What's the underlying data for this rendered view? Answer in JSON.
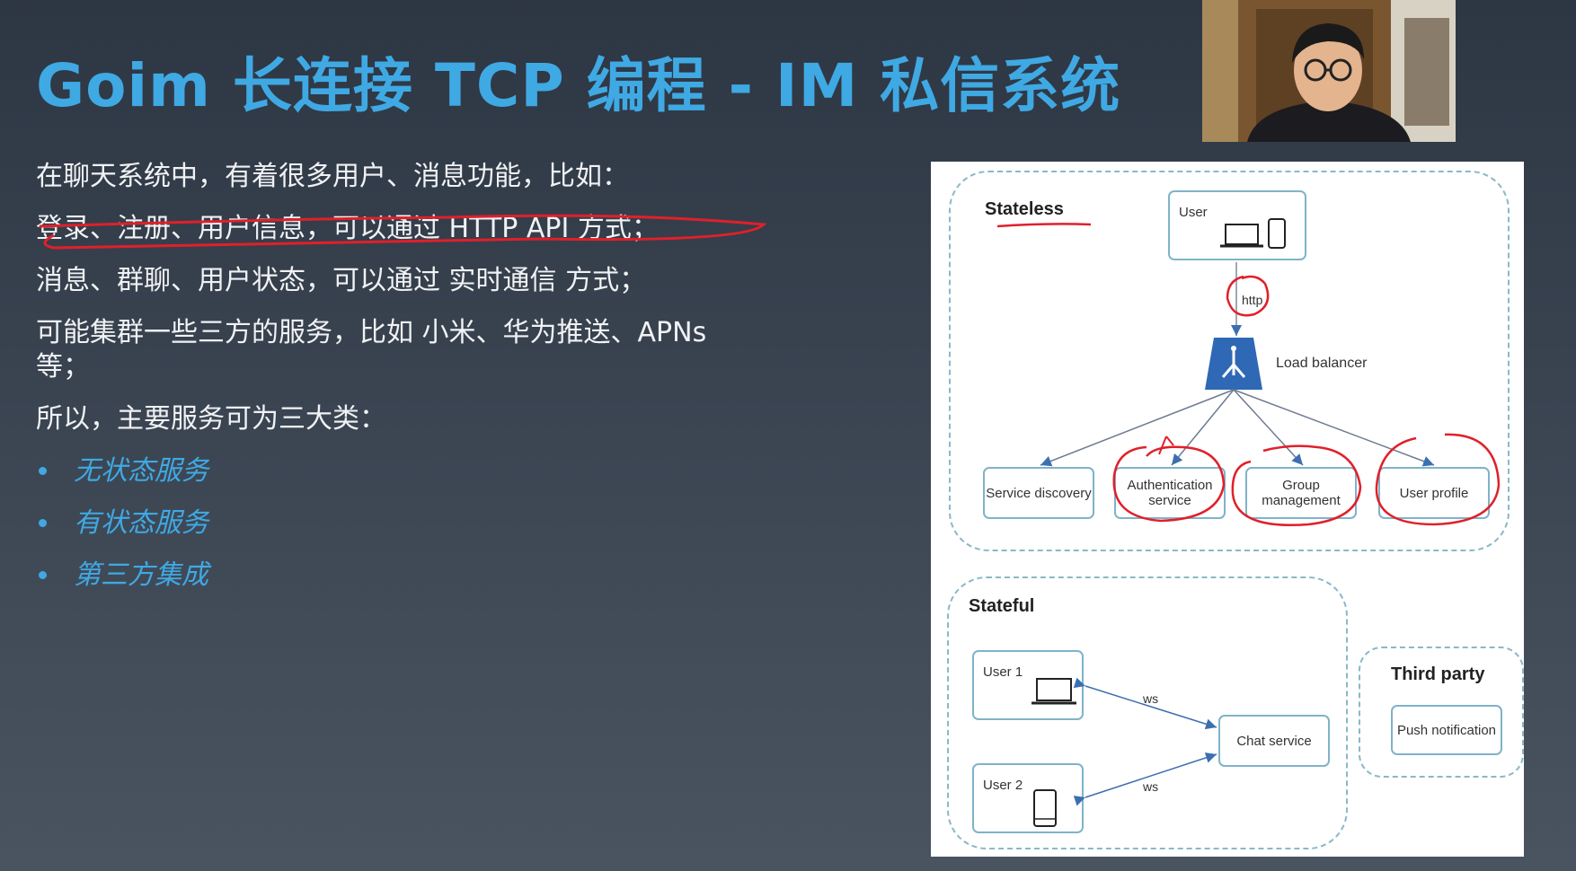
{
  "slide": {
    "title": "Goim 长连接 TCP 编程 - IM 私信系统",
    "lines": [
      "在聊天系统中，有着很多用户、消息功能，比如：",
      "登录、注册、用户信息，可以通过 HTTP API 方式；",
      "消息、群聊、用户状态，可以通过 实时通信 方式；",
      "可能集群一些三方的服务，比如 小米、华为推送、APNs 等；",
      "所以，主要服务可为三大类："
    ],
    "bullets": [
      "无状态服务",
      "有状态服务",
      "第三方集成"
    ]
  },
  "diagram": {
    "stateless_label": "Stateless",
    "user_label": "User",
    "http_label": "http",
    "load_balancer_label": "Load balancer",
    "services": {
      "service_discovery": "Service discovery",
      "authentication": "Authentication service",
      "group_management": "Group management",
      "user_profile": "User profile"
    },
    "stateful_label": "Stateful",
    "user1_label": "User 1",
    "user2_label": "User 2",
    "ws_label": "ws",
    "chat_service_label": "Chat service",
    "third_party_label": "Third party",
    "push_notification_label": "Push notification"
  },
  "colors": {
    "title_blue": "#3fa9e4",
    "annotation_red": "#e0202a",
    "box_border": "#7fb3c9",
    "load_balancer": "#2f68b4"
  }
}
